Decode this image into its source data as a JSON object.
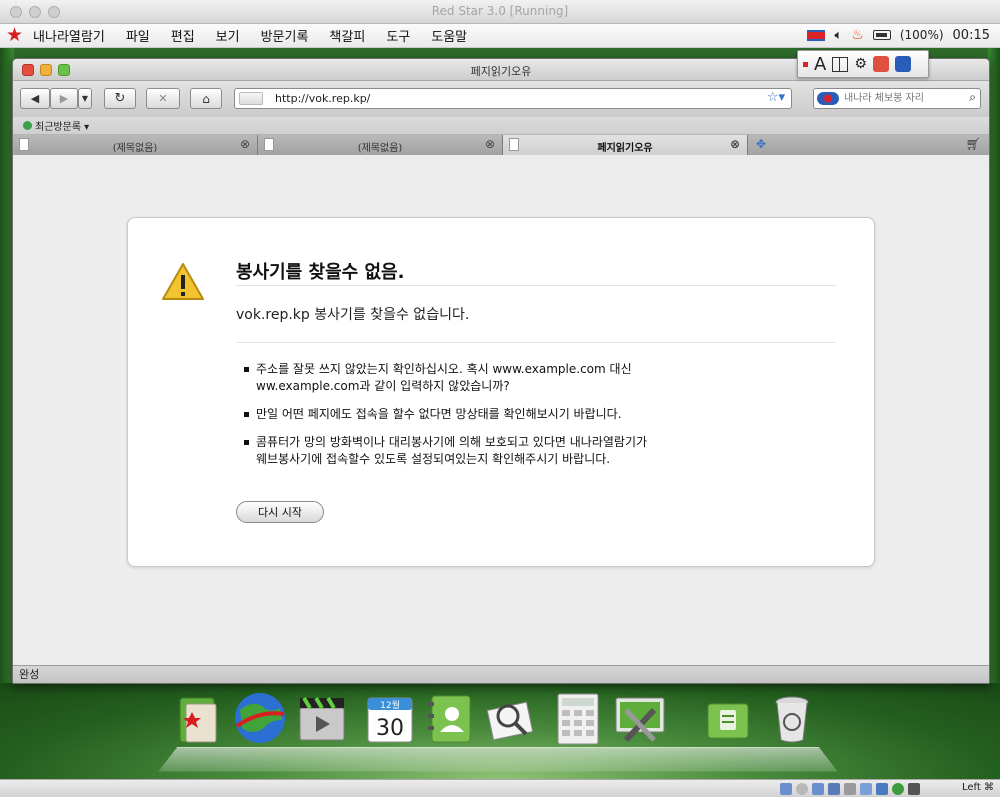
{
  "host_window": {
    "title": "Red Star 3.0 [Running]"
  },
  "os_menubar": {
    "items": [
      "내나라열람기",
      "파일",
      "편집",
      "보기",
      "방문기록",
      "책갈피",
      "도구",
      "도움말"
    ],
    "battery": "(100%)",
    "clock": "00:15"
  },
  "ime_palette": {
    "letter": "A"
  },
  "browser": {
    "window_title": "페지읽기오유",
    "url": "http://vok.rep.kp/",
    "search_placeholder": "내나라 체보봉 자리",
    "bookmarks_label": "최근방문록 ▾",
    "tabs": [
      {
        "label": "(제목없음)",
        "active": false
      },
      {
        "label": "(제목없음)",
        "active": false
      },
      {
        "label": "페지읽기오유",
        "active": true
      }
    ],
    "status": "완성"
  },
  "error_page": {
    "title": "봉사기를 찾을수 없음.",
    "description": "vok.rep.kp 봉사기를 찾을수 없습니다.",
    "items": [
      {
        "line1": "주소를 잘못 쓰지 않았는지 확인하십시오. 혹시 www.example.com 대신",
        "line2": "ww.example.com과 같이 입력하지 않았습니까?"
      },
      {
        "line1": "만일 어떤 페지에도 접속을 할수 없다면 망상태를 확인해보시기 바랍니다.",
        "line2": ""
      },
      {
        "line1": "콤퓨터가 망의 방화벽이나 대리봉사기에 의해 보호되고 있다면 내나라열람기가",
        "line2": "웨브봉사기에 접속할수 있도록 설정되여있는지 확인해주시기 바랍니다."
      }
    ],
    "retry_label": "다시 시작"
  },
  "dock": {
    "calendar_month": "12월",
    "calendar_day": "30",
    "items": [
      "folder-icon",
      "globe-icon",
      "video-icon",
      "calendar-icon",
      "contacts-icon",
      "image-viewer-icon",
      "calculator-icon",
      "settings-icon",
      "trash-folder-icon",
      "trash-can-icon"
    ]
  },
  "host_status": {
    "host_key": "Left ⌘"
  },
  "colors": {
    "accent_red": "#d81e1e",
    "desktop_green": "#2f6b2a",
    "warning_yellow": "#f4c430"
  }
}
